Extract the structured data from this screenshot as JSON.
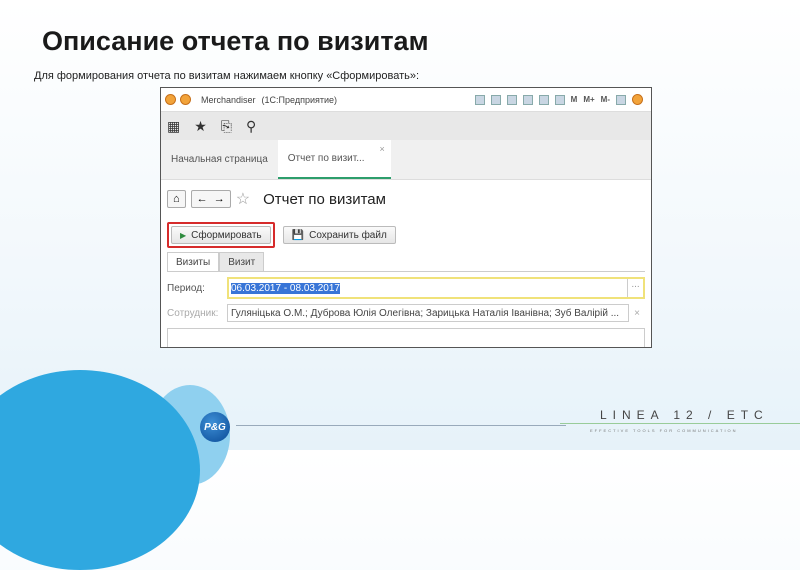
{
  "slide": {
    "title": "Описание отчета по визитам",
    "subtitle": "Для формирования отчета по визитам нажимаем кнопку «Сформировать»:"
  },
  "window": {
    "app": "Merchandiser",
    "platform": "(1С:Предприятие)",
    "toolbar_m": [
      "M",
      "M+",
      "M-"
    ]
  },
  "tabs": [
    {
      "label": "Начальная страница"
    },
    {
      "label": "Отчет по визит..."
    }
  ],
  "report": {
    "title": "Отчет по визитам",
    "generate": "Сформировать",
    "save": "Сохранить файл"
  },
  "form_tabs": [
    "Визиты",
    "Визит"
  ],
  "fields": {
    "period_label": "Период:",
    "period_value": "06.03.2017 - 08.03.2017",
    "employee_label": "Сотрудник:",
    "employee_value": "Гуляніцька О.М.; Дуброва Юлія Олегівна; Зарицька Наталія Іванівна; Зуб Валірій ..."
  },
  "branding": {
    "pg": "P&G",
    "linea": "LINEA 12 / ETC",
    "tagline": "EFFECTIVE TOOLS FOR COMMUNICATION"
  }
}
